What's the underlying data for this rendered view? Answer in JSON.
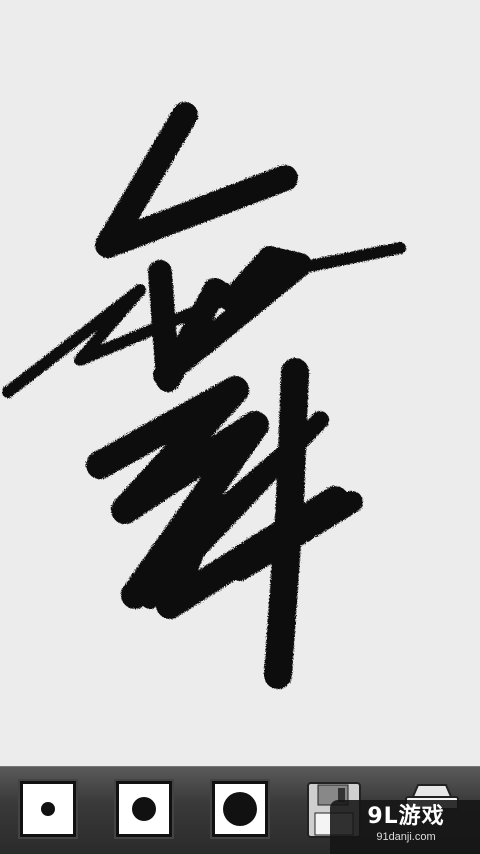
{
  "canvas": {
    "background_color": "#ececec",
    "ink_color": "#111111"
  },
  "toolbar": {
    "brushes": [
      {
        "name": "brush-small",
        "icon": "small-dot-icon",
        "size_level": 1
      },
      {
        "name": "brush-medium",
        "icon": "medium-dot-icon",
        "size_level": 2
      },
      {
        "name": "brush-large",
        "icon": "large-dot-icon",
        "size_level": 3
      }
    ],
    "save_icon": "floppy-disk-icon",
    "clear_icon": "eraser-icon"
  },
  "watermark": {
    "logo": "9L游戏",
    "url": "91danji.com"
  }
}
